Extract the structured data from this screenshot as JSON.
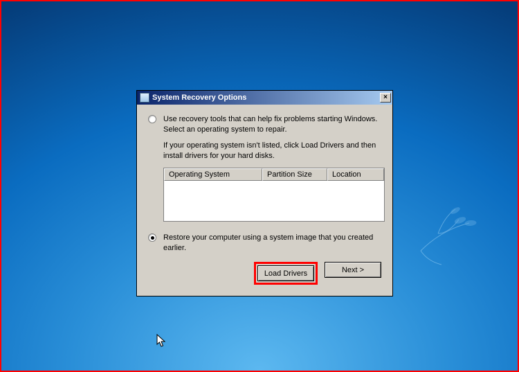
{
  "dialog": {
    "title": "System Recovery Options",
    "close_label": "×",
    "option1_text": "Use recovery tools that can help fix problems starting Windows. Select an operating system to repair.",
    "hint_text": "If your operating system isn't listed, click Load Drivers and then install drivers for your hard disks.",
    "table": {
      "col1": "Operating System",
      "col2": "Partition Size",
      "col3": "Location"
    },
    "option2_text": "Restore your computer using a system image that you created earlier.",
    "selected_option": 2,
    "buttons": {
      "load_drivers": "Load Drivers",
      "next": "Next >"
    }
  },
  "colors": {
    "highlight": "#ff0000",
    "dialog_bg": "#d4d0c8",
    "titlebar_start": "#0a246a",
    "titlebar_end": "#a6caf0"
  }
}
